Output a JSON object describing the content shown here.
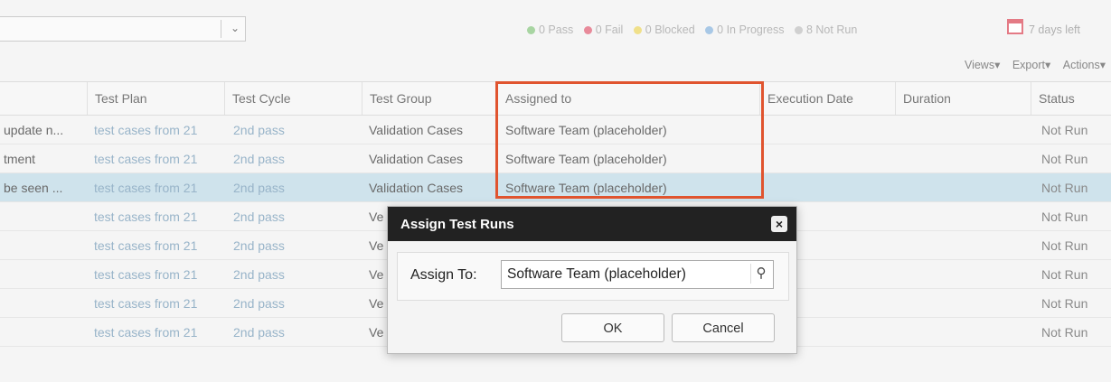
{
  "filter": {
    "value": ""
  },
  "stats": [
    {
      "label": "0 Pass",
      "color": "#a8d5a2"
    },
    {
      "label": "0 Fail",
      "color": "#e88a9a"
    },
    {
      "label": "0 Blocked",
      "color": "#f0e08a"
    },
    {
      "label": "0 In Progress",
      "color": "#a8c8e6"
    },
    {
      "label": "8 Not Run",
      "color": "#d0d0d0"
    }
  ],
  "days_left": "7 days left",
  "toolbar": {
    "views": "Views▾",
    "export": "Export▾",
    "actions": "Actions▾"
  },
  "columns": {
    "test_plan": "Test Plan",
    "test_cycle": "Test Cycle",
    "test_group": "Test Group",
    "assigned_to": "Assigned to",
    "execution_date": "Execution Date",
    "duration": "Duration",
    "status": "Status"
  },
  "rows": [
    {
      "name": "update n...",
      "plan": "test cases from 21",
      "cycle": "2nd pass",
      "group": "Validation Cases",
      "assigned": "Software Team (placeholder)",
      "status": "Not Run"
    },
    {
      "name": "tment",
      "plan": "test cases from 21",
      "cycle": "2nd pass",
      "group": "Validation Cases",
      "assigned": "Software Team (placeholder)",
      "status": "Not Run"
    },
    {
      "name": "be seen ...",
      "plan": "test cases from 21",
      "cycle": "2nd pass",
      "group": "Validation Cases",
      "assigned": "Software Team (placeholder)",
      "status": "Not Run"
    },
    {
      "name": "",
      "plan": "test cases from 21",
      "cycle": "2nd pass",
      "group": "Ve",
      "assigned": "",
      "status": "Not Run"
    },
    {
      "name": "",
      "plan": "test cases from 21",
      "cycle": "2nd pass",
      "group": "Ve",
      "assigned": "",
      "status": "Not Run"
    },
    {
      "name": "",
      "plan": "test cases from 21",
      "cycle": "2nd pass",
      "group": "Ve",
      "assigned": "",
      "status": "Not Run"
    },
    {
      "name": "",
      "plan": "test cases from 21",
      "cycle": "2nd pass",
      "group": "Ve",
      "assigned": "",
      "status": "Not Run"
    },
    {
      "name": "",
      "plan": "test cases from 21",
      "cycle": "2nd pass",
      "group": "Ve",
      "assigned": "",
      "status": "Not Run"
    }
  ],
  "dialog": {
    "title": "Assign Test Runs",
    "close": "×",
    "assign_label": "Assign To:",
    "assign_value": "Software Team (placeholder)",
    "ok": "OK",
    "cancel": "Cancel"
  }
}
